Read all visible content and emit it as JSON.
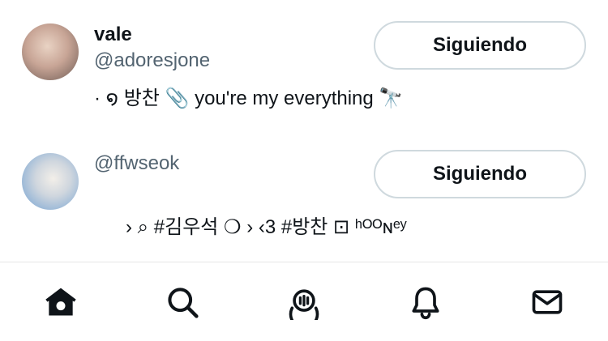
{
  "users": [
    {
      "name": "vale",
      "handle": "@adoresjone",
      "bio": "· ໑ 방찬 📎 you're my everything 🔭",
      "follow_label": "Siguiendo"
    },
    {
      "name": "",
      "handle": "@ffwseok",
      "bio": "› ⌕ #김우석   ❍ › ‹3 #방찬 ⊡ ʰᴼᴼɴᵉʸ",
      "follow_label": "Siguiendo"
    }
  ],
  "tabbar": {
    "items": [
      "home-icon",
      "search-icon",
      "spaces-icon",
      "notifications-icon",
      "messages-icon"
    ],
    "active": "home-icon"
  },
  "colors": {
    "text": "#0f1419",
    "muted": "#536471",
    "border": "#cfd9de"
  }
}
